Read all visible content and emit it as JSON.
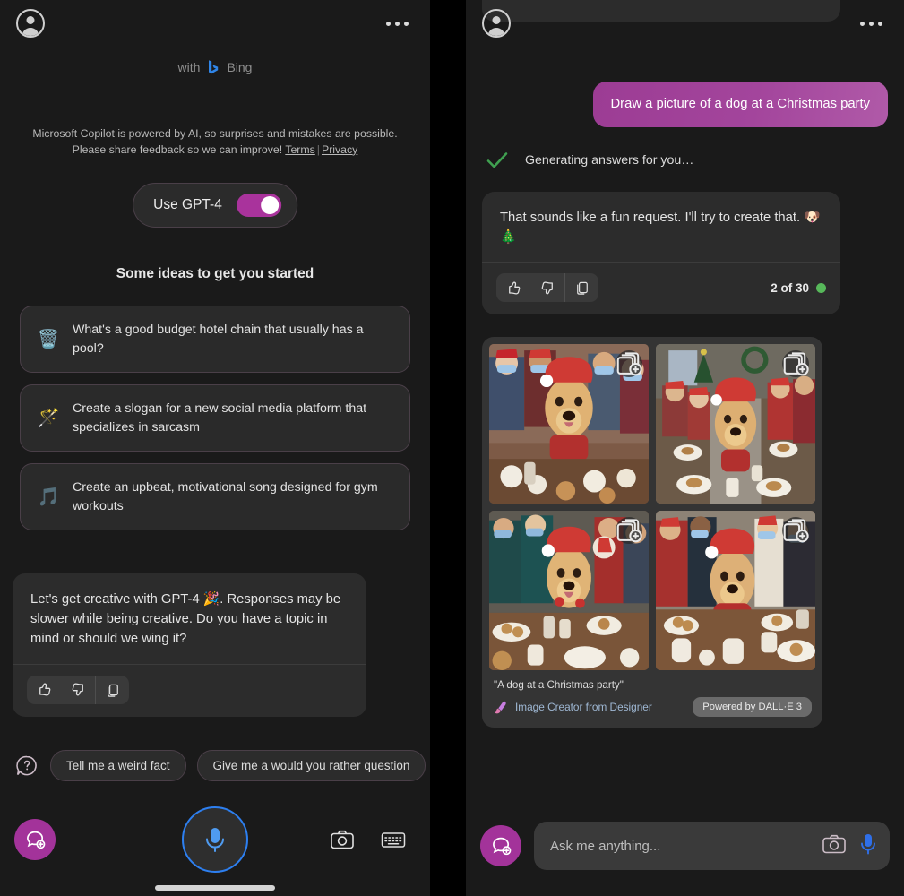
{
  "left_panel": {
    "topbar": {
      "avatar_icon": "account-circle-icon",
      "overflow_icon": "more-options-icon"
    },
    "branding": {
      "with_label": "with",
      "bing_label": "Bing",
      "bing_icon": "bing-logo-icon"
    },
    "disclaimer": {
      "text": "Microsoft Copilot is powered by AI, so surprises and mistakes are possible. Please share feedback so we can improve!",
      "terms_label": "Terms",
      "privacy_label": "Privacy",
      "separator": "|"
    },
    "gpt_toggle": {
      "label": "Use GPT-4",
      "state": "on",
      "accent_color": "#A9339C"
    },
    "ideas_title": "Some ideas to get you started",
    "ideas": [
      {
        "icon": "wastebasket-icon",
        "glyph": "🗑️",
        "text": "What's a good budget hotel chain that usually has a pool?"
      },
      {
        "icon": "magic-wand-icon",
        "glyph": "🪄",
        "text": "Create a slogan for a new social media platform that specializes in sarcasm"
      },
      {
        "icon": "music-note-icon",
        "glyph": "🎵",
        "text": "Create an upbeat, motivational song designed for gym workouts"
      }
    ],
    "bot_message": {
      "text": "Let's get creative with GPT-4 🎉. Responses may be slower while being creative. Do you have a topic in mind or should we wing it?",
      "actions": [
        {
          "icon": "thumbs-up-icon",
          "label": "Like"
        },
        {
          "icon": "thumbs-down-icon",
          "label": "Dislike"
        },
        {
          "icon": "copy-icon",
          "label": "Copy"
        }
      ]
    },
    "suggestion_chips": {
      "help_icon": "question-chat-icon",
      "items": [
        "Tell me a weird fact",
        "Give me a would you rather question",
        ""
      ]
    },
    "action_bar": {
      "new_chat_icon": "new-chat-plus-icon",
      "mic_icon": "microphone-icon",
      "camera_icon": "camera-icon",
      "keyboard_icon": "keyboard-icon"
    }
  },
  "right_panel": {
    "topbar": {
      "avatar_icon": "account-circle-icon",
      "overflow_icon": "more-options-icon"
    },
    "user_message": "Draw a picture of a dog at a Christmas party",
    "generating_status": {
      "check_icon": "check-mark-icon",
      "text": "Generating answers for you…"
    },
    "bot_message": {
      "text": "That sounds like a fun request. I'll try to create that. 🐶🎄",
      "actions": [
        {
          "icon": "thumbs-up-icon",
          "label": "Like"
        },
        {
          "icon": "thumbs-down-icon",
          "label": "Dislike"
        },
        {
          "icon": "copy-icon",
          "label": "Copy"
        }
      ],
      "counter_text": "2 of 30",
      "counter_dot_color": "#57b85a"
    },
    "image_card": {
      "caption": "\"A dog at a Christmas party\"",
      "creator_label": "Image Creator from Designer",
      "creator_icon": "image-creator-brush-icon",
      "powered_label": "Powered by DALL·E 3",
      "stack_icon": "add-to-collection-icon",
      "images": [
        {
          "alt": "Golden retriever in santa hat with masked friends and cookies"
        },
        {
          "alt": "Golden retriever at a long holiday table with gingerbread"
        },
        {
          "alt": "Golden retriever with people in ugly christmas sweaters"
        },
        {
          "alt": "Golden retriever in red outfit with group holding mugs"
        }
      ]
    },
    "input_bar": {
      "new_chat_icon": "new-chat-plus-icon",
      "placeholder": "Ask me anything...",
      "camera_icon": "camera-icon",
      "mic_icon": "microphone-icon"
    }
  }
}
